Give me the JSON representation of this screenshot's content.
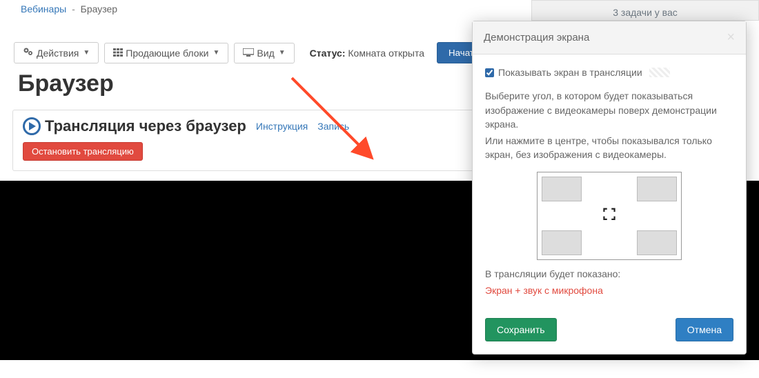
{
  "breadcrumb": {
    "root": "Вебинары",
    "current": "Браузер"
  },
  "tasks": {
    "line1": "3 задачи у вас"
  },
  "toolbar": {
    "actions_label": "Действия",
    "blocks_label": "Продающие блоки",
    "view_label": "Вид",
    "status_label": "Статус:",
    "status_value": "Комната открыта",
    "start_label": "Начать трансляцию"
  },
  "page_title": "Браузер",
  "broadcast": {
    "title": "Трансляция через браузер",
    "instruction_link": "Инструкция",
    "record_link": "Запись",
    "stop_label": "Остановить трансляцию"
  },
  "modal": {
    "title": "Демонстрация экрана",
    "checkbox_label": "Показывать экран в трансляции",
    "help1": "Выберите угол, в котором будет показываться изображение с видеокамеры поверх демонстрации экрана.",
    "help2": "Или нажмите в центре, чтобы показывался только экран, без изображения с видеокамеры.",
    "info_label": "В трансляции будет показано:",
    "info_value": "Экран + звук с микрофона",
    "save_label": "Сохранить",
    "cancel_label": "Отмена"
  }
}
